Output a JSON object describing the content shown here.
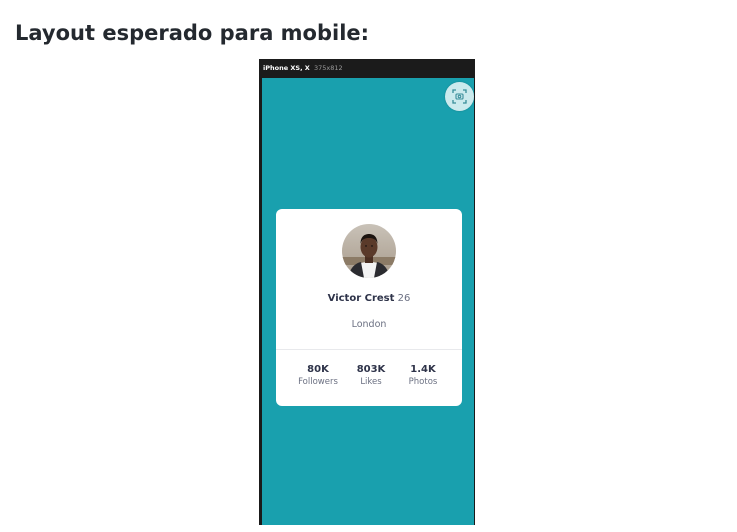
{
  "heading": "Layout esperado para mobile:",
  "device": {
    "name": "iPhone XS, X",
    "size": "375x812",
    "screenshot_icon": "camera-frame-icon"
  },
  "profile": {
    "avatar_icon": "profile-photo",
    "name": "Victor Crest",
    "age": "26",
    "city": "London"
  },
  "stats": [
    {
      "value": "80K",
      "label": "Followers"
    },
    {
      "value": "803K",
      "label": "Likes"
    },
    {
      "value": "1.4K",
      "label": "Photos"
    }
  ],
  "colors": {
    "background": "#19a0ae",
    "card": "#ffffff",
    "text_dark": "#2e3349",
    "text_muted": "#6b7082"
  }
}
